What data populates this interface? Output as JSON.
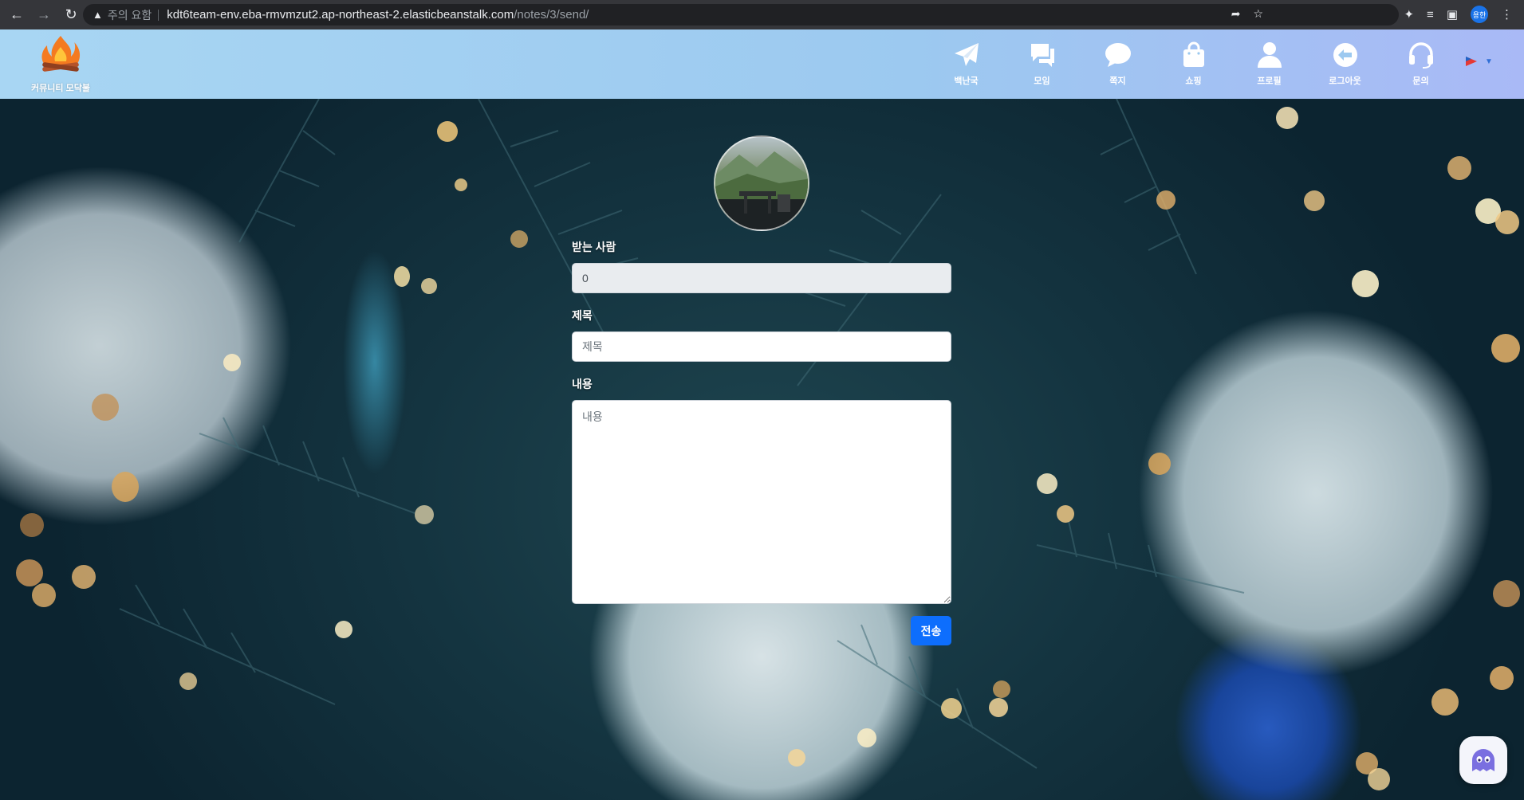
{
  "browser": {
    "security_warning": "주의 요함",
    "url_host": "kdt6team-env.eba-rmvmzut2.ap-northeast-2.elasticbeanstalk.com",
    "url_path": "/notes/3/send/",
    "profile_initials": "용한"
  },
  "header": {
    "logo_text": "커뮤니티 모닥불",
    "nav_items": [
      {
        "label": "백난국",
        "icon": "paper-plane-icon"
      },
      {
        "label": "모임",
        "icon": "chat-bubbles-icon"
      },
      {
        "label": "쪽지",
        "icon": "speech-bubble-icon"
      },
      {
        "label": "쇼핑",
        "icon": "shopping-bag-icon"
      },
      {
        "label": "프로필",
        "icon": "person-icon"
      },
      {
        "label": "로그아웃",
        "icon": "logout-arrow-icon"
      },
      {
        "label": "문의",
        "icon": "headset-icon"
      }
    ]
  },
  "form": {
    "recipient_label": "받는 사람",
    "recipient_value": "0",
    "title_label": "제목",
    "title_placeholder": "제목",
    "content_label": "내용",
    "content_placeholder": "내용",
    "submit_label": "전송"
  },
  "colors": {
    "accent": "#0d6efd",
    "header_gradient_start": "#a8d6f3",
    "header_gradient_end": "#a9b9f6"
  }
}
